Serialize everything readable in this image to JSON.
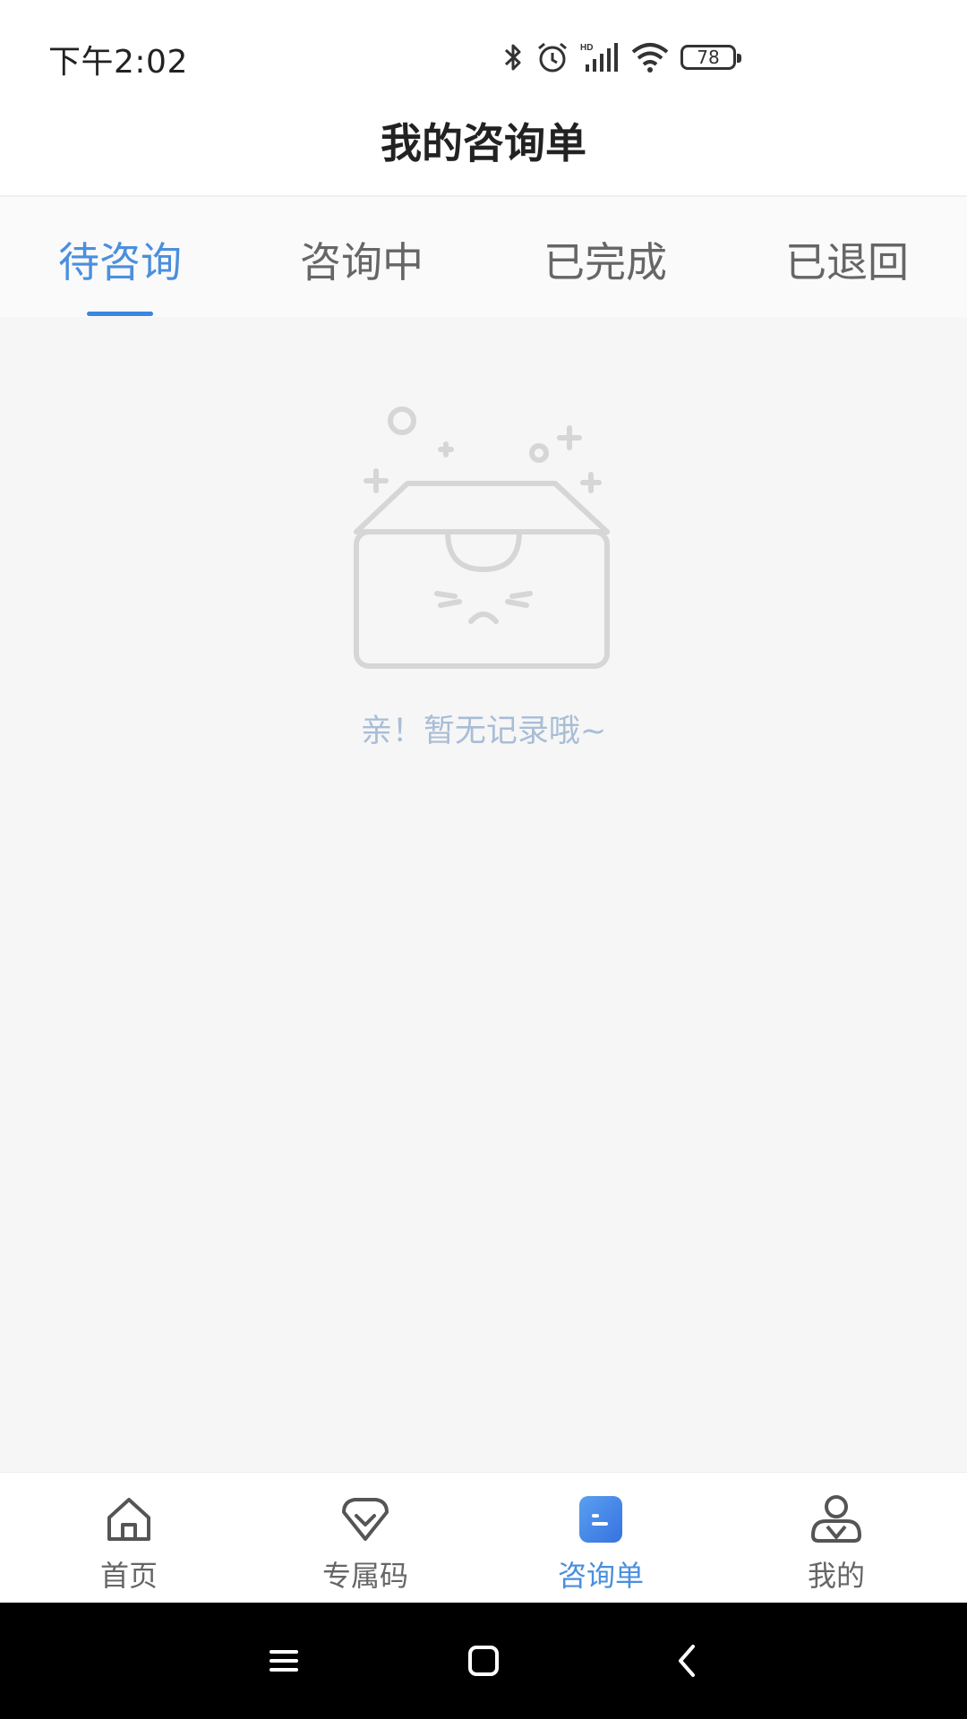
{
  "status_bar": {
    "time": "下午2:02",
    "battery": "78",
    "icons": [
      "bluetooth-icon",
      "alarm-icon",
      "hd-signal-icon",
      "wifi-icon",
      "battery-icon"
    ]
  },
  "header": {
    "title": "我的咨询单"
  },
  "tabs": [
    {
      "label": "待咨询",
      "active": true
    },
    {
      "label": "咨询中",
      "active": false
    },
    {
      "label": "已完成",
      "active": false
    },
    {
      "label": "已退回",
      "active": false
    }
  ],
  "empty_state": {
    "icon": "empty-box-icon",
    "message": "亲！暂无记录哦~"
  },
  "bottom_nav": [
    {
      "label": "首页",
      "icon": "home-icon",
      "active": false
    },
    {
      "label": "专属码",
      "icon": "diamond-icon",
      "active": false
    },
    {
      "label": "咨询单",
      "icon": "document-icon",
      "active": true
    },
    {
      "label": "我的",
      "icon": "user-icon",
      "active": false
    }
  ],
  "colors": {
    "accent": "#4a8fde",
    "indicator": "#3a86e0",
    "empty_text": "#a8bdd6",
    "background": "#f6f6f6"
  },
  "system_nav": [
    "menu-icon",
    "home-square-icon",
    "back-icon"
  ]
}
